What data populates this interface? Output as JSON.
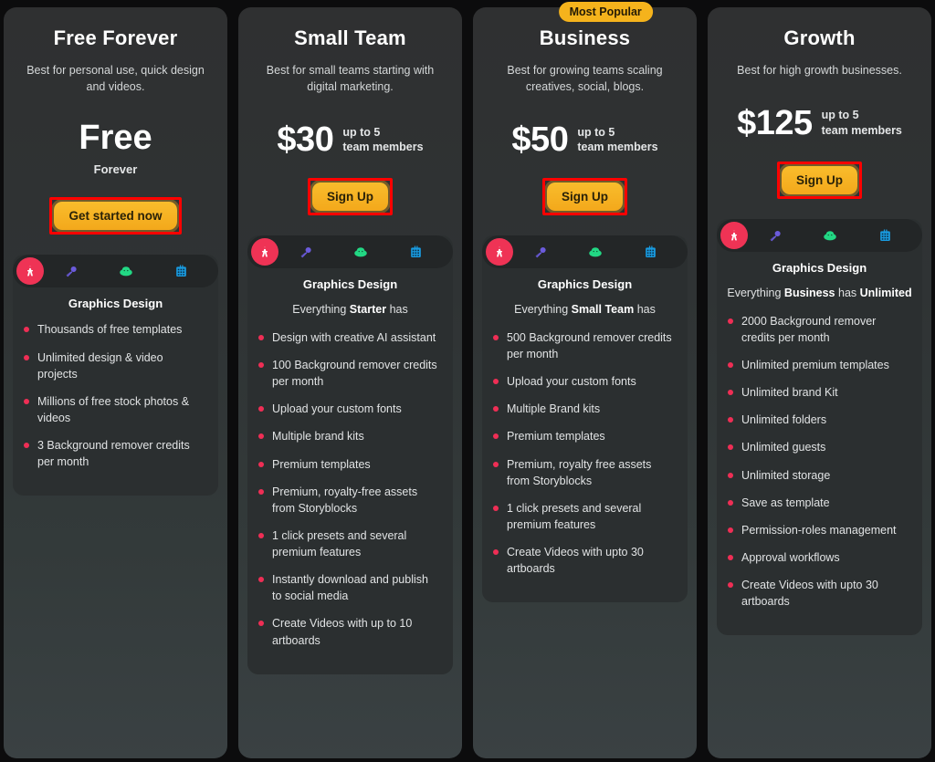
{
  "colors": {
    "page_background": "#0c0c0d",
    "card_background_top": "#2f3031",
    "card_background_bottom": "#3a4143",
    "panel_background": "#2b2f30",
    "cta_yellow": "#f5b31c",
    "bullet_red": "#ef2e55",
    "badge_yellow": "#f5b31c",
    "annotation_red": "#ff0000",
    "active_tab_red": "#ef3355",
    "icon_purple": "#6b5bdc",
    "icon_green": "#22d884",
    "icon_blue": "#199be0"
  },
  "icon_tabs": [
    {
      "name": "graphics-design-icon",
      "label": "Graphics Design",
      "active": true
    },
    {
      "name": "rocket-icon",
      "label": "Marketing",
      "active": false
    },
    {
      "name": "cloud-icon",
      "label": "Social",
      "active": false
    },
    {
      "name": "building-icon",
      "label": "Business",
      "active": false
    }
  ],
  "plans": [
    {
      "id": "free-forever",
      "title": "Free Forever",
      "description": "Best for personal use, quick design and videos.",
      "price_display": "Free",
      "price_period": "Forever",
      "price_note": "",
      "badge": "",
      "cta_label": "Get started now",
      "cta_highlighted": true,
      "feature_category": "Graphics Design",
      "feature_note_prefix": "",
      "feature_note_bold": "",
      "feature_note_suffix": "",
      "feature_note_bold2": "",
      "features": [
        "Thousands of free templates",
        "Unlimited design & video projects",
        "Millions of free stock photos & videos",
        "3 Background remover credits per month"
      ]
    },
    {
      "id": "small-team",
      "title": "Small Team",
      "description": "Best for small teams starting with digital marketing.",
      "price_display": "$30",
      "price_period": "",
      "price_note": "up to 5\nteam members",
      "badge": "",
      "cta_label": "Sign Up",
      "cta_highlighted": true,
      "feature_category": "Graphics Design",
      "feature_note_prefix": "Everything ",
      "feature_note_bold": "Starter",
      "feature_note_suffix": " has",
      "feature_note_bold2": "",
      "features": [
        "Design with creative AI assistant",
        "100 Background remover credits per month",
        "Upload your custom fonts",
        "Multiple brand kits",
        "Premium templates",
        "Premium, royalty-free assets from Storyblocks",
        "1 click presets and several premium features",
        "Instantly download and publish to social media",
        "Create Videos with up to 10 artboards"
      ]
    },
    {
      "id": "business",
      "title": "Business",
      "description": "Best for growing teams scaling creatives, social,  blogs.",
      "price_display": "$50",
      "price_period": "",
      "price_note": "up to 5\nteam members",
      "badge": "Most Popular",
      "cta_label": "Sign Up",
      "cta_highlighted": true,
      "feature_category": "Graphics Design",
      "feature_note_prefix": "Everything ",
      "feature_note_bold": "Small Team",
      "feature_note_suffix": " has",
      "feature_note_bold2": "",
      "features": [
        "500 Background remover credits per month",
        "Upload your custom fonts",
        "Multiple Brand kits",
        "Premium templates",
        "Premium, royalty free assets from Storyblocks",
        "1 click presets and several premium features",
        "Create Videos with upto 30 artboards"
      ]
    },
    {
      "id": "growth",
      "title": "Growth",
      "description": "Best for high growth businesses.",
      "price_display": "$125",
      "price_period": "",
      "price_note": "up to 5\nteam members",
      "badge": "",
      "cta_label": "Sign Up",
      "cta_highlighted": true,
      "feature_category": "Graphics Design",
      "feature_note_prefix": "Everything ",
      "feature_note_bold": "Business",
      "feature_note_suffix": " has",
      "feature_note_bold2": "Unlimited",
      "features": [
        "2000 Background remover credits per month",
        "Unlimited premium templates",
        "Unlimited brand Kit",
        "Unlimited folders",
        "Unlimited guests",
        "Unlimited storage",
        "Save as template",
        "Permission-roles management",
        "Approval workflows",
        "Create Videos with upto 30 artboards"
      ]
    }
  ]
}
